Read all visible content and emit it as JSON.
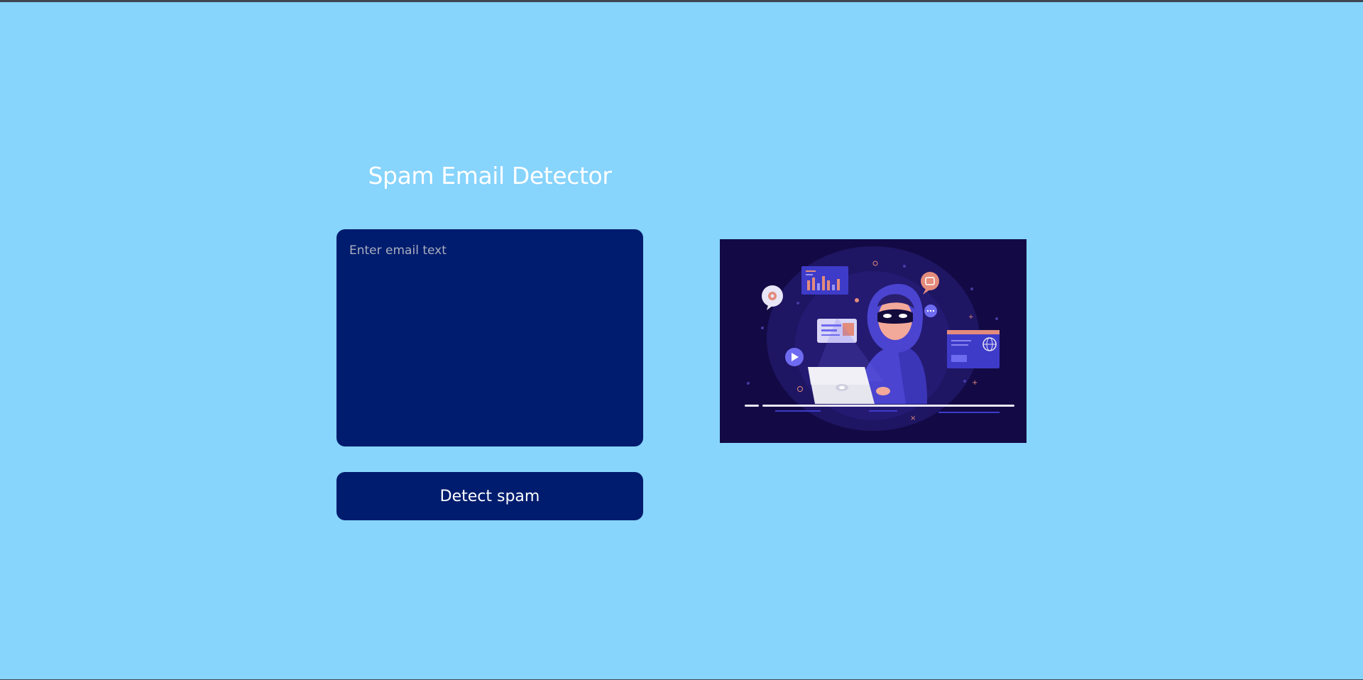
{
  "page": {
    "title": "Spam Email Detector",
    "background_color": "#87d4fd",
    "panel_color": "#001c6e"
  },
  "email_input": {
    "value": "",
    "placeholder": "Enter email text"
  },
  "detect_button": {
    "label": "Detect spam"
  },
  "illustration": {
    "subject": "hooded hacker at laptop",
    "icon_names": [
      "bar-chart-icon",
      "gear-icon",
      "email-icon",
      "chat-icon",
      "play-icon",
      "globe-icon",
      "laptop-icon"
    ]
  }
}
